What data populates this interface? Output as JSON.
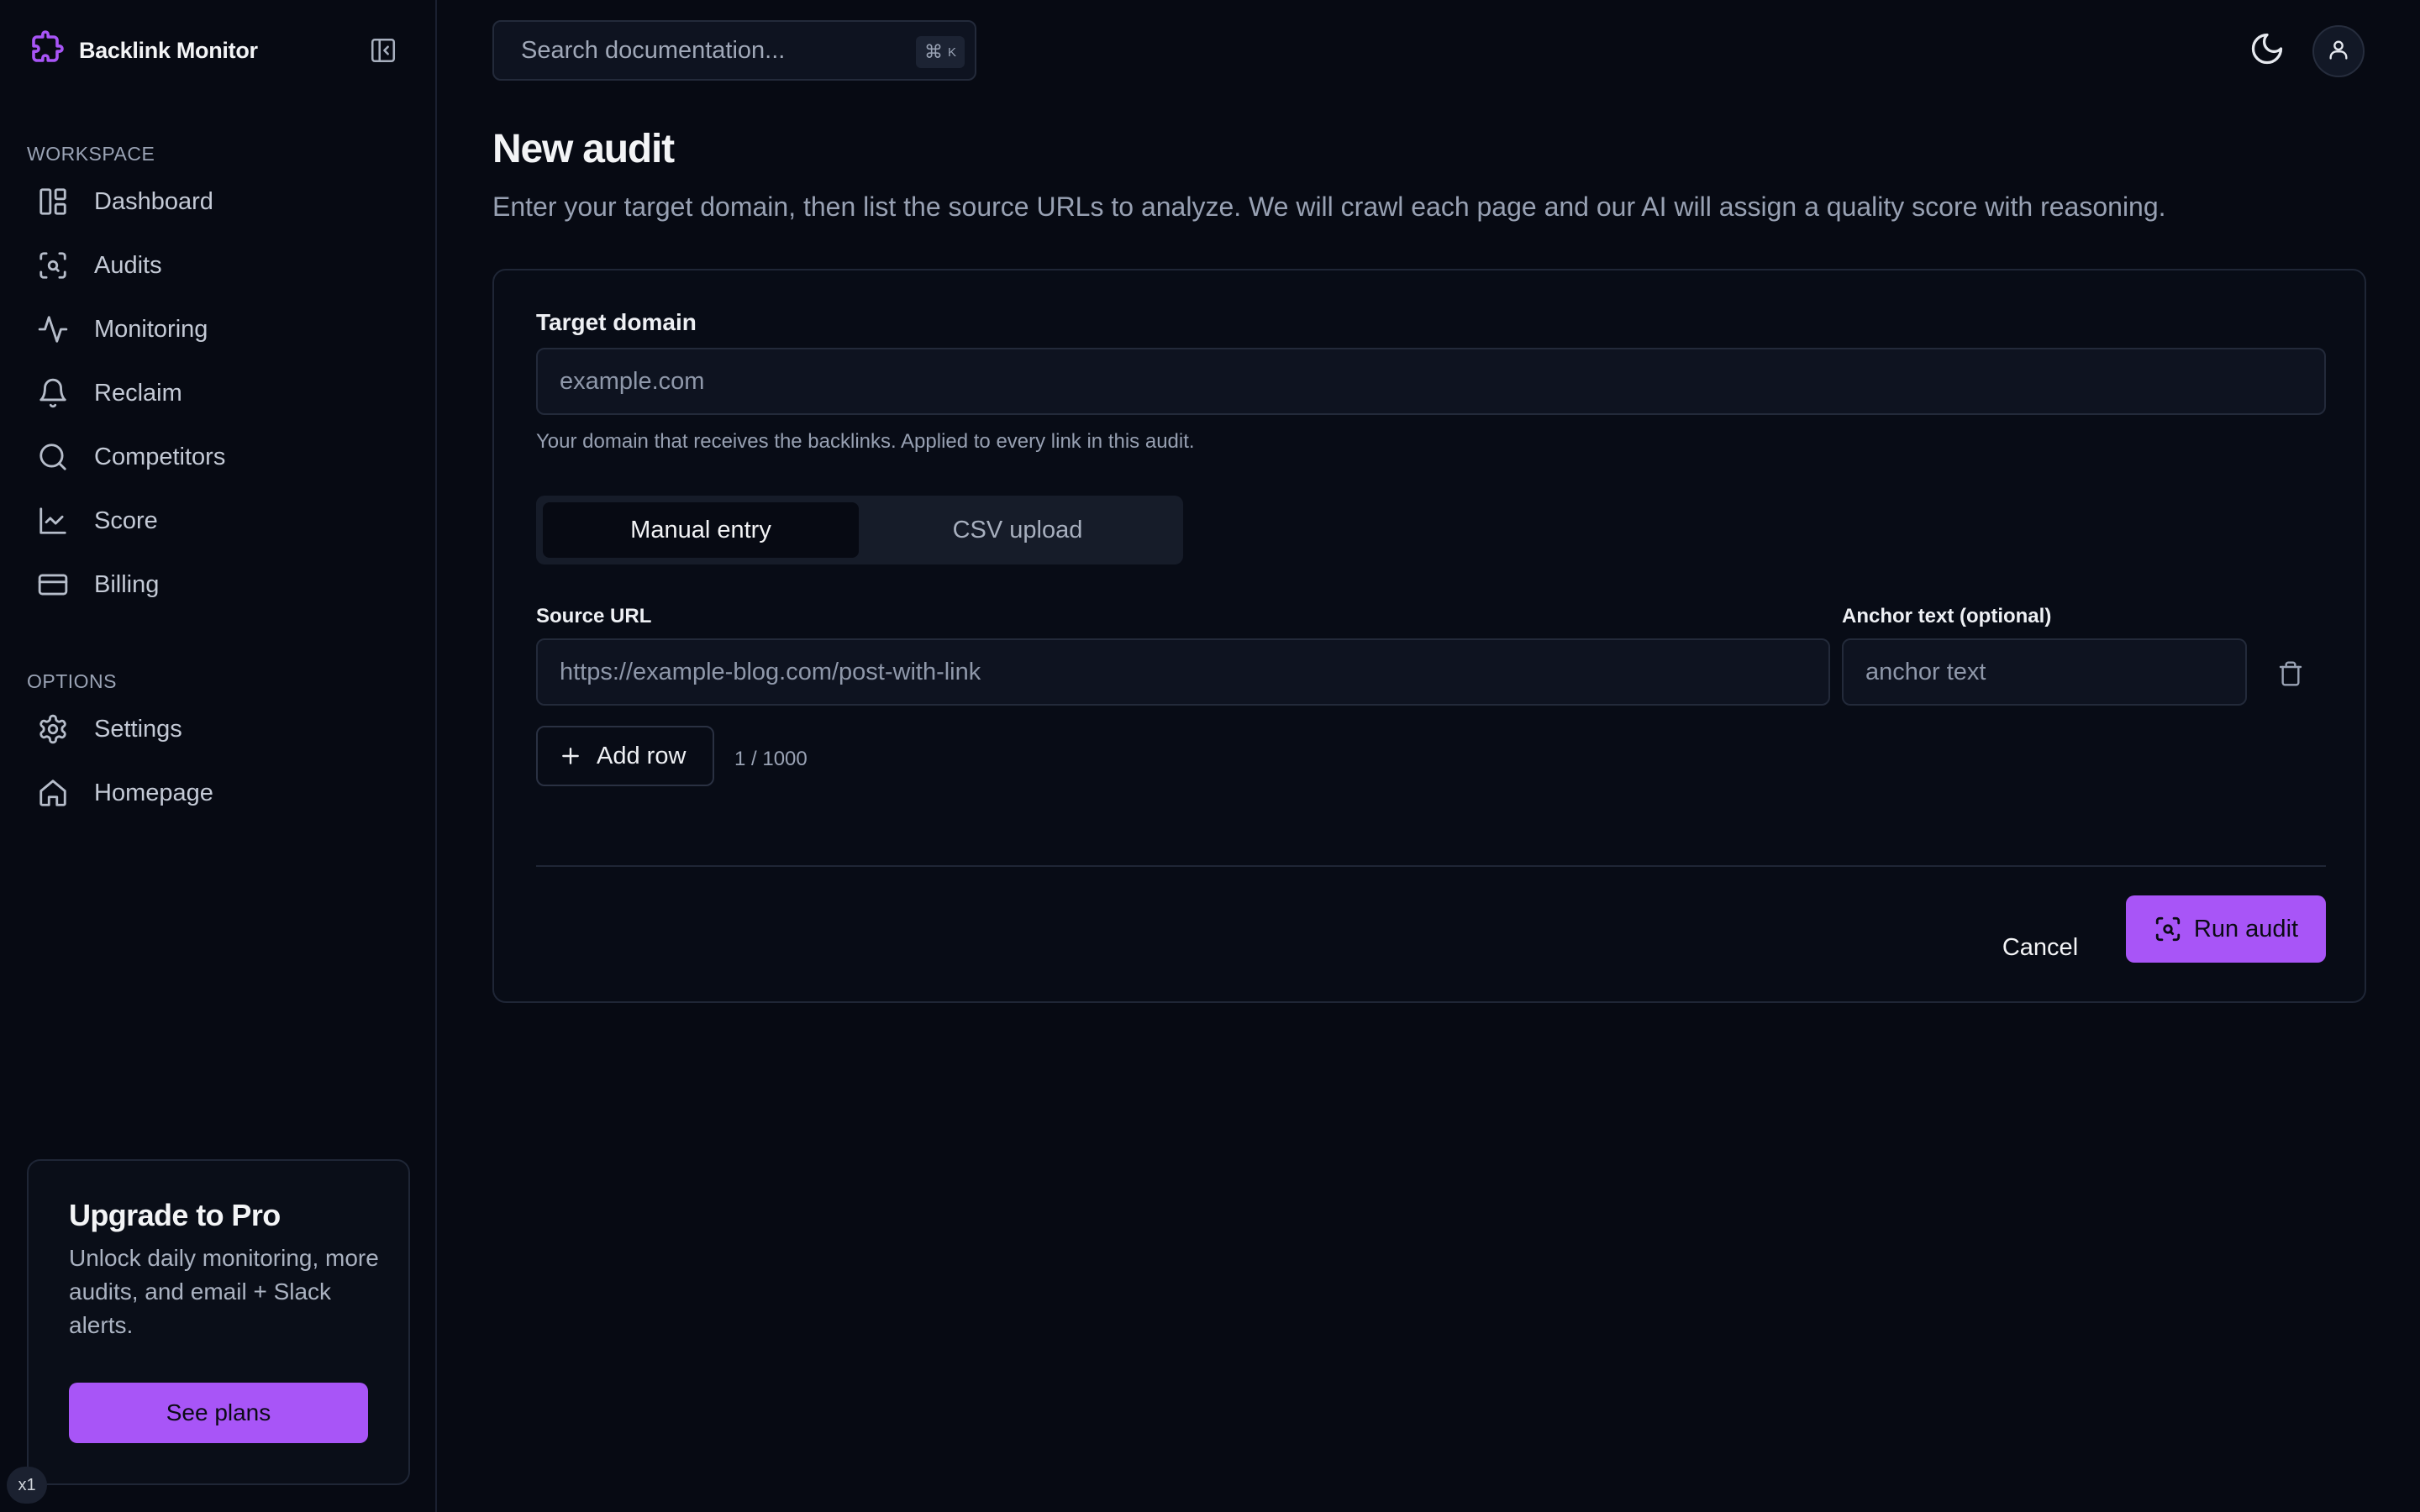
{
  "app": {
    "name": "Backlink Monitor",
    "icons": {
      "logo": "puzzle-logo-icon",
      "collapse": "sidebar-collapse-icon"
    },
    "accent_color": "#a855f7"
  },
  "sidebar": {
    "sections": [
      {
        "label": "WORKSPACE",
        "items": [
          {
            "label": "Dashboard",
            "icon": "dashboard-icon"
          },
          {
            "label": "Audits",
            "icon": "scan-search-icon"
          },
          {
            "label": "Monitoring",
            "icon": "activity-icon"
          },
          {
            "label": "Reclaim",
            "icon": "bell-icon"
          },
          {
            "label": "Competitors",
            "icon": "search-icon"
          },
          {
            "label": "Score",
            "icon": "line-chart-icon"
          },
          {
            "label": "Billing",
            "icon": "credit-card-icon"
          }
        ]
      },
      {
        "label": "OPTIONS",
        "items": [
          {
            "label": "Settings",
            "icon": "gear-icon"
          },
          {
            "label": "Homepage",
            "icon": "home-icon"
          }
        ]
      }
    ],
    "upgrade": {
      "title": "Upgrade to Pro",
      "description": "Unlock daily monitoring, more audits, and email + Slack alerts.",
      "button_label": "See plans"
    },
    "zoom_badge": "x1"
  },
  "header": {
    "search_placeholder": "Search documentation...",
    "search_shortcut": {
      "symbol": "⌘",
      "key": "K"
    },
    "theme_toggle_icon": "moon-icon",
    "avatar_icon": "user-icon"
  },
  "main": {
    "title": "New audit",
    "subtitle": "Enter your target domain, then list the source URLs to analyze. We will crawl each page and our AI will assign a quality score with reasoning.",
    "form": {
      "target_domain_label": "Target domain",
      "target_domain_placeholder": "example.com",
      "target_domain_value": "",
      "target_domain_hint": "Your domain that receives the backlinks. Applied to every link in this audit.",
      "tabs": [
        {
          "label": "Manual entry",
          "active": true
        },
        {
          "label": "CSV upload",
          "active": false
        }
      ],
      "source_url_label": "Source URL",
      "anchor_text_label": "Anchor text (optional)",
      "rows": [
        {
          "source_url_placeholder": "https://example-blog.com/post-with-link",
          "anchor_placeholder": "anchor text"
        }
      ],
      "add_row_label": "Add row",
      "row_counter": "1 / 1000",
      "cancel_label": "Cancel",
      "submit_label": "Run audit"
    }
  }
}
